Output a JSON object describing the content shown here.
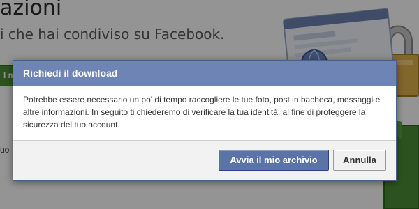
{
  "background": {
    "title": "azioni",
    "subtitle": "i che hai condiviso su Facebook.",
    "green_button_fragment": "l m",
    "left_fragment": "uo"
  },
  "dialog": {
    "title": "Richiedi il download",
    "message": "Potrebbe essere necessario un po' di tempo raccogliere le tue foto, post in bacheca, messaggi e altre informazioni. In seguito ti chiederemo di verificare la tua identità, al fine di proteggere la sicurezza del tuo account.",
    "primary_button": "Avvia il mio archivio",
    "cancel_button": "Annulla"
  },
  "colors": {
    "header_bg": "#6d84b4",
    "primary_button_bg": "#5b74a8",
    "archive_green": "#4d8f36"
  },
  "illustration": {
    "icons": [
      "window-icon",
      "globe-icon",
      "lock-icon",
      "download-arrow-icon"
    ]
  }
}
